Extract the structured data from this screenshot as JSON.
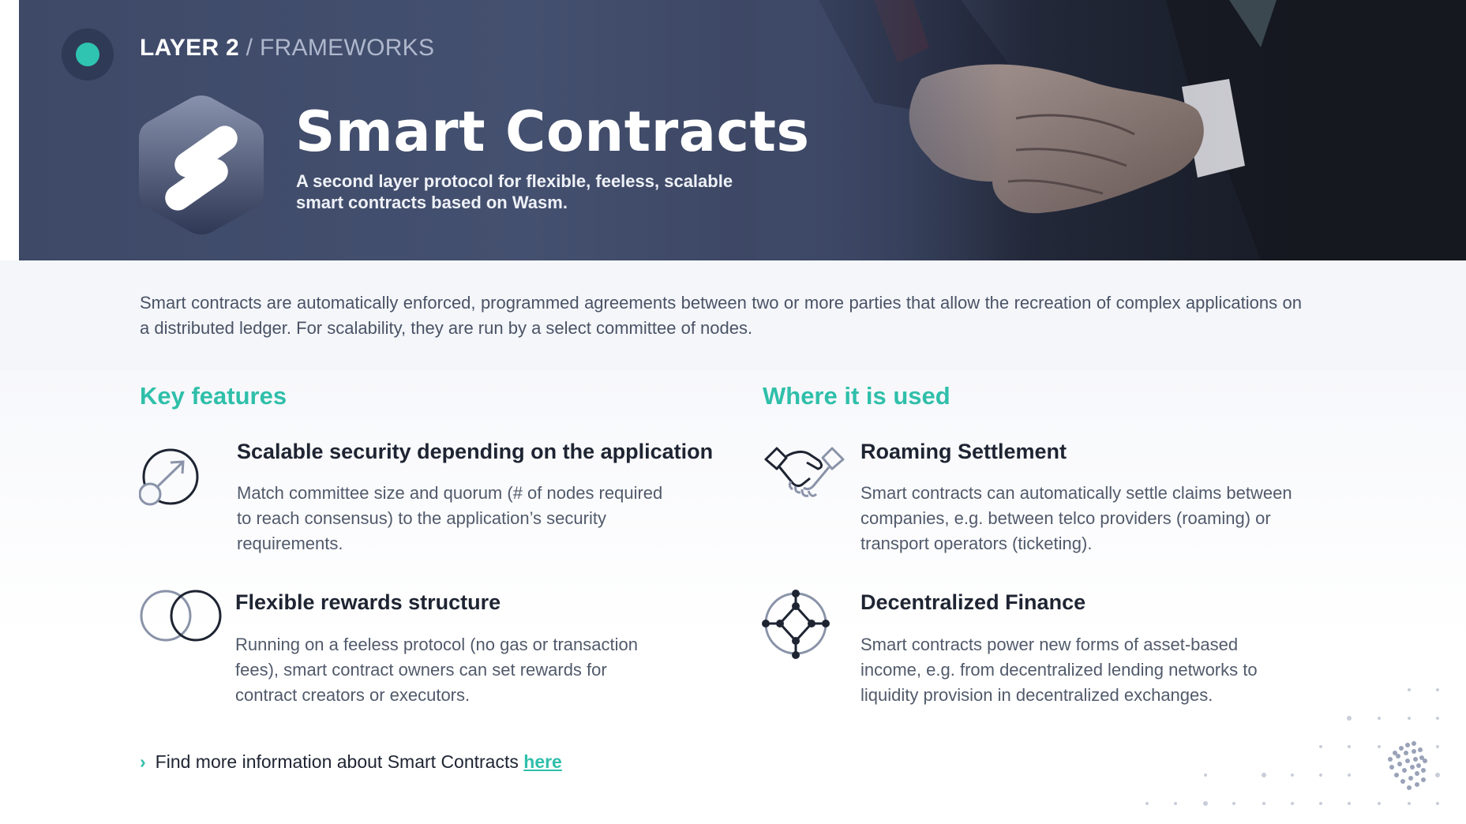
{
  "header": {
    "breadcrumb_strong": "LAYER 2",
    "breadcrumb_sep": " / ",
    "breadcrumb_light": "FRAMEWORKS",
    "title": "Smart Contracts",
    "subtitle": "A second layer protocol for flexible, feeless, scalable smart contracts based on Wasm."
  },
  "intro": "Smart contracts are automatically enforced, programmed agreements between two or more parties that allow the recreation of complex applications on a distributed ledger. For scalability, they are run by a select committee of nodes.",
  "key_features": {
    "heading": "Key features",
    "items": [
      {
        "title": "Scalable security depending on the application",
        "description": "Match committee size and quorum (# of nodes required to reach consensus) to the application’s security requirements.",
        "icon": "scale-circle-icon"
      },
      {
        "title": "Flexible rewards structure",
        "description": "Running on a feeless protocol (no gas or transaction fees), smart contract owners can set rewards for contract creators or executors.",
        "icon": "overlapping-circles-icon"
      }
    ]
  },
  "use_cases": {
    "heading": "Where it is used",
    "items": [
      {
        "title": "Roaming Settlement",
        "description": "Smart contracts can automatically settle claims between companies, e.g. between telco providers (roaming) or transport operators (ticketing).",
        "icon": "handshake-icon"
      },
      {
        "title": "Decentralized Finance",
        "description": "Smart contracts power new forms of asset-based income, e.g. from decentralized lending networks to liquidity provision in decentralized exchanges.",
        "icon": "network-node-icon"
      }
    ]
  },
  "footer": {
    "more_text": "Find more information about Smart Contracts ",
    "more_link": "here"
  },
  "colors": {
    "accent": "#2fbfaa",
    "hero_bg": "#3e4968",
    "text_dark": "#1e2432",
    "text_body": "#515a6b"
  }
}
